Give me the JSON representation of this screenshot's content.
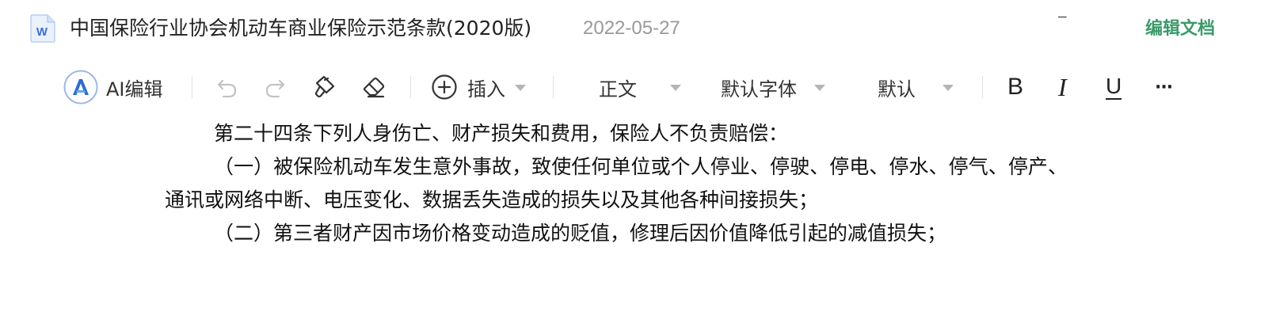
{
  "header": {
    "title": "中国保险行业协会机动车商业保险示范条款(2020版)",
    "date": "2022-05-27",
    "edit_link": "编辑文档",
    "doc_icon_letter": "W"
  },
  "toolbar": {
    "ai_label": "AI编辑",
    "insert_label": "插入",
    "paragraph_style": "正文",
    "font_family": "默认字体",
    "font_size": "默认",
    "bold_glyph": "B",
    "italic_glyph": "I",
    "underline_glyph": "U",
    "more_glyph": "···"
  },
  "content": {
    "paragraphs": [
      "第二十四条下列人身伤亡、财产损失和费用，保险人不负责赔偿：",
      "（一）被保险机动车发生意外事故，致使任何单位或个人停业、停驶、停电、停水、停气、停产、通讯或网络中断、电压变化、数据丢失造成的损失以及其他各种间接损失；",
      "（二）第三者财产因市场价格变动造成的贬值，修理后因价值降低引起的减值损失；"
    ]
  },
  "colors": {
    "accent_green": "#3a9a6a",
    "ai_blue": "#2f6bd8",
    "word_blue": "#3b6fd6"
  },
  "icons": {
    "doc": "word-doc-icon",
    "ai": "ai-logo-icon",
    "undo": "undo-icon",
    "redo": "redo-icon",
    "format_painter": "format-painter-icon",
    "eraser": "clear-format-icon",
    "insert": "plus-circle-icon"
  }
}
